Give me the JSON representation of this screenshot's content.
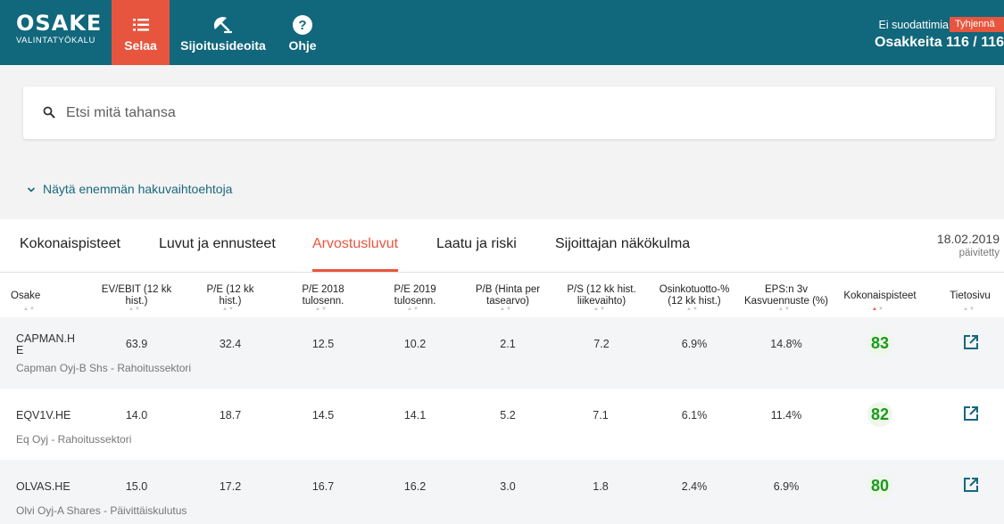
{
  "header": {
    "logo_title": "OSAKE",
    "logo_subtitle": "VALINTATYÖKALU",
    "nav": [
      {
        "label": "Selaa",
        "icon": "list-icon",
        "active": true
      },
      {
        "label": "Sijoitusideoita",
        "icon": "umbrella-icon",
        "active": false
      },
      {
        "label": "Ohje",
        "icon": "help-icon",
        "active": false
      }
    ],
    "filter_status": "Ei suodattimia",
    "clear_label": "Tyhjennä",
    "count_label": "Osakkeita 116 / 116"
  },
  "search": {
    "placeholder": "Etsi mitä tahansa",
    "icon": "search-icon"
  },
  "more_options_label": "Näytä enemmän hakuvaihtoehtoja",
  "tabs": [
    {
      "label": "Kokonaispisteet",
      "active": false
    },
    {
      "label": "Luvut ja ennusteet",
      "active": false
    },
    {
      "label": "Arvostusluvut",
      "active": true
    },
    {
      "label": "Laatu ja riski",
      "active": false
    },
    {
      "label": "Sijoittajan näkökulma",
      "active": false
    }
  ],
  "updated": {
    "date": "18.02.2019",
    "label": "päivitetty"
  },
  "table": {
    "columns": [
      "Osake",
      "EV/EBIT (12 kk hist.)",
      "P/E (12 kk hist.)",
      "P/E 2018 tulosenn.",
      "P/E 2019 tulosenn.",
      "P/B (Hinta per tasearvo)",
      "P/S (12 kk hist. liikevaihto)",
      "Osinkotuotto-% (12 kk hist.)",
      "EPS:n 3v Kasvuennuste (%)",
      "Kokonaispisteet",
      "Tietosivu"
    ],
    "sorted_column": "Kokonaispisteet",
    "rows": [
      {
        "ticker": "CAPMAN.HE",
        "company": "Capman Oyj-B Shs - Rahoitussektori",
        "values": [
          "63.9",
          "32.4",
          "12.5",
          "10.2",
          "2.1",
          "7.2",
          "6.9%",
          "14.8%"
        ],
        "score": "83"
      },
      {
        "ticker": "EQV1V.HE",
        "company": "Eq Oyj - Rahoitussektori",
        "values": [
          "14.0",
          "18.7",
          "14.5",
          "14.1",
          "5.2",
          "7.1",
          "6.1%",
          "11.4%"
        ],
        "score": "82"
      },
      {
        "ticker": "OLVAS.HE",
        "company": "Olvi Oyj-A Shares - Päivittäiskulutus",
        "values": [
          "15.0",
          "17.2",
          "16.7",
          "16.2",
          "3.0",
          "1.8",
          "2.4%",
          "6.9%"
        ],
        "score": "80"
      }
    ]
  },
  "colors": {
    "header_bg": "#11677c",
    "accent": "#e8553e",
    "score_green": "#1a9a1a",
    "link": "#17687d"
  }
}
